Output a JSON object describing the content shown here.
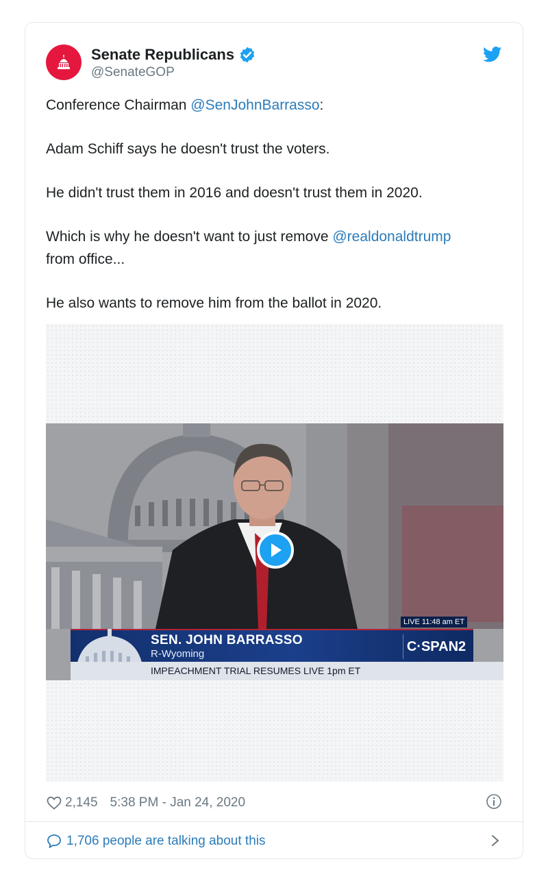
{
  "author": {
    "display_name": "Senate Republicans",
    "handle": "@SenateGOP",
    "avatar_color": "#e5173f"
  },
  "tweet": {
    "line1_prefix": "Conference Chairman ",
    "line1_mention": "@SenJohnBarrasso",
    "line1_suffix": ":",
    "line2": "Adam Schiff says he doesn't trust the voters.",
    "line3": "He didn't trust them in 2016 and doesn't trust them in 2020.",
    "line4_prefix": "Which is why he doesn't want to just remove ",
    "line4_mention": "@realdonaldtrump",
    "line4_suffix": "from office...",
    "line5": "He also wants to remove him from the ballot in 2020."
  },
  "video": {
    "live_label": "LIVE 11:48 am ET",
    "name_chyron": "SEN. JOHN BARRASSO",
    "state_chyron": "R-Wyoming",
    "network": "C·SPAN2",
    "ticker": "IMPEACHMENT TRIAL RESUMES LIVE 1pm ET"
  },
  "footer": {
    "likes": "2,145",
    "timestamp": "5:38 PM - Jan 24, 2020",
    "talking": "1,706 people are talking about this"
  },
  "colors": {
    "link": "#2b7bb9",
    "twitter_blue": "#1da1f2",
    "muted": "#697882"
  }
}
